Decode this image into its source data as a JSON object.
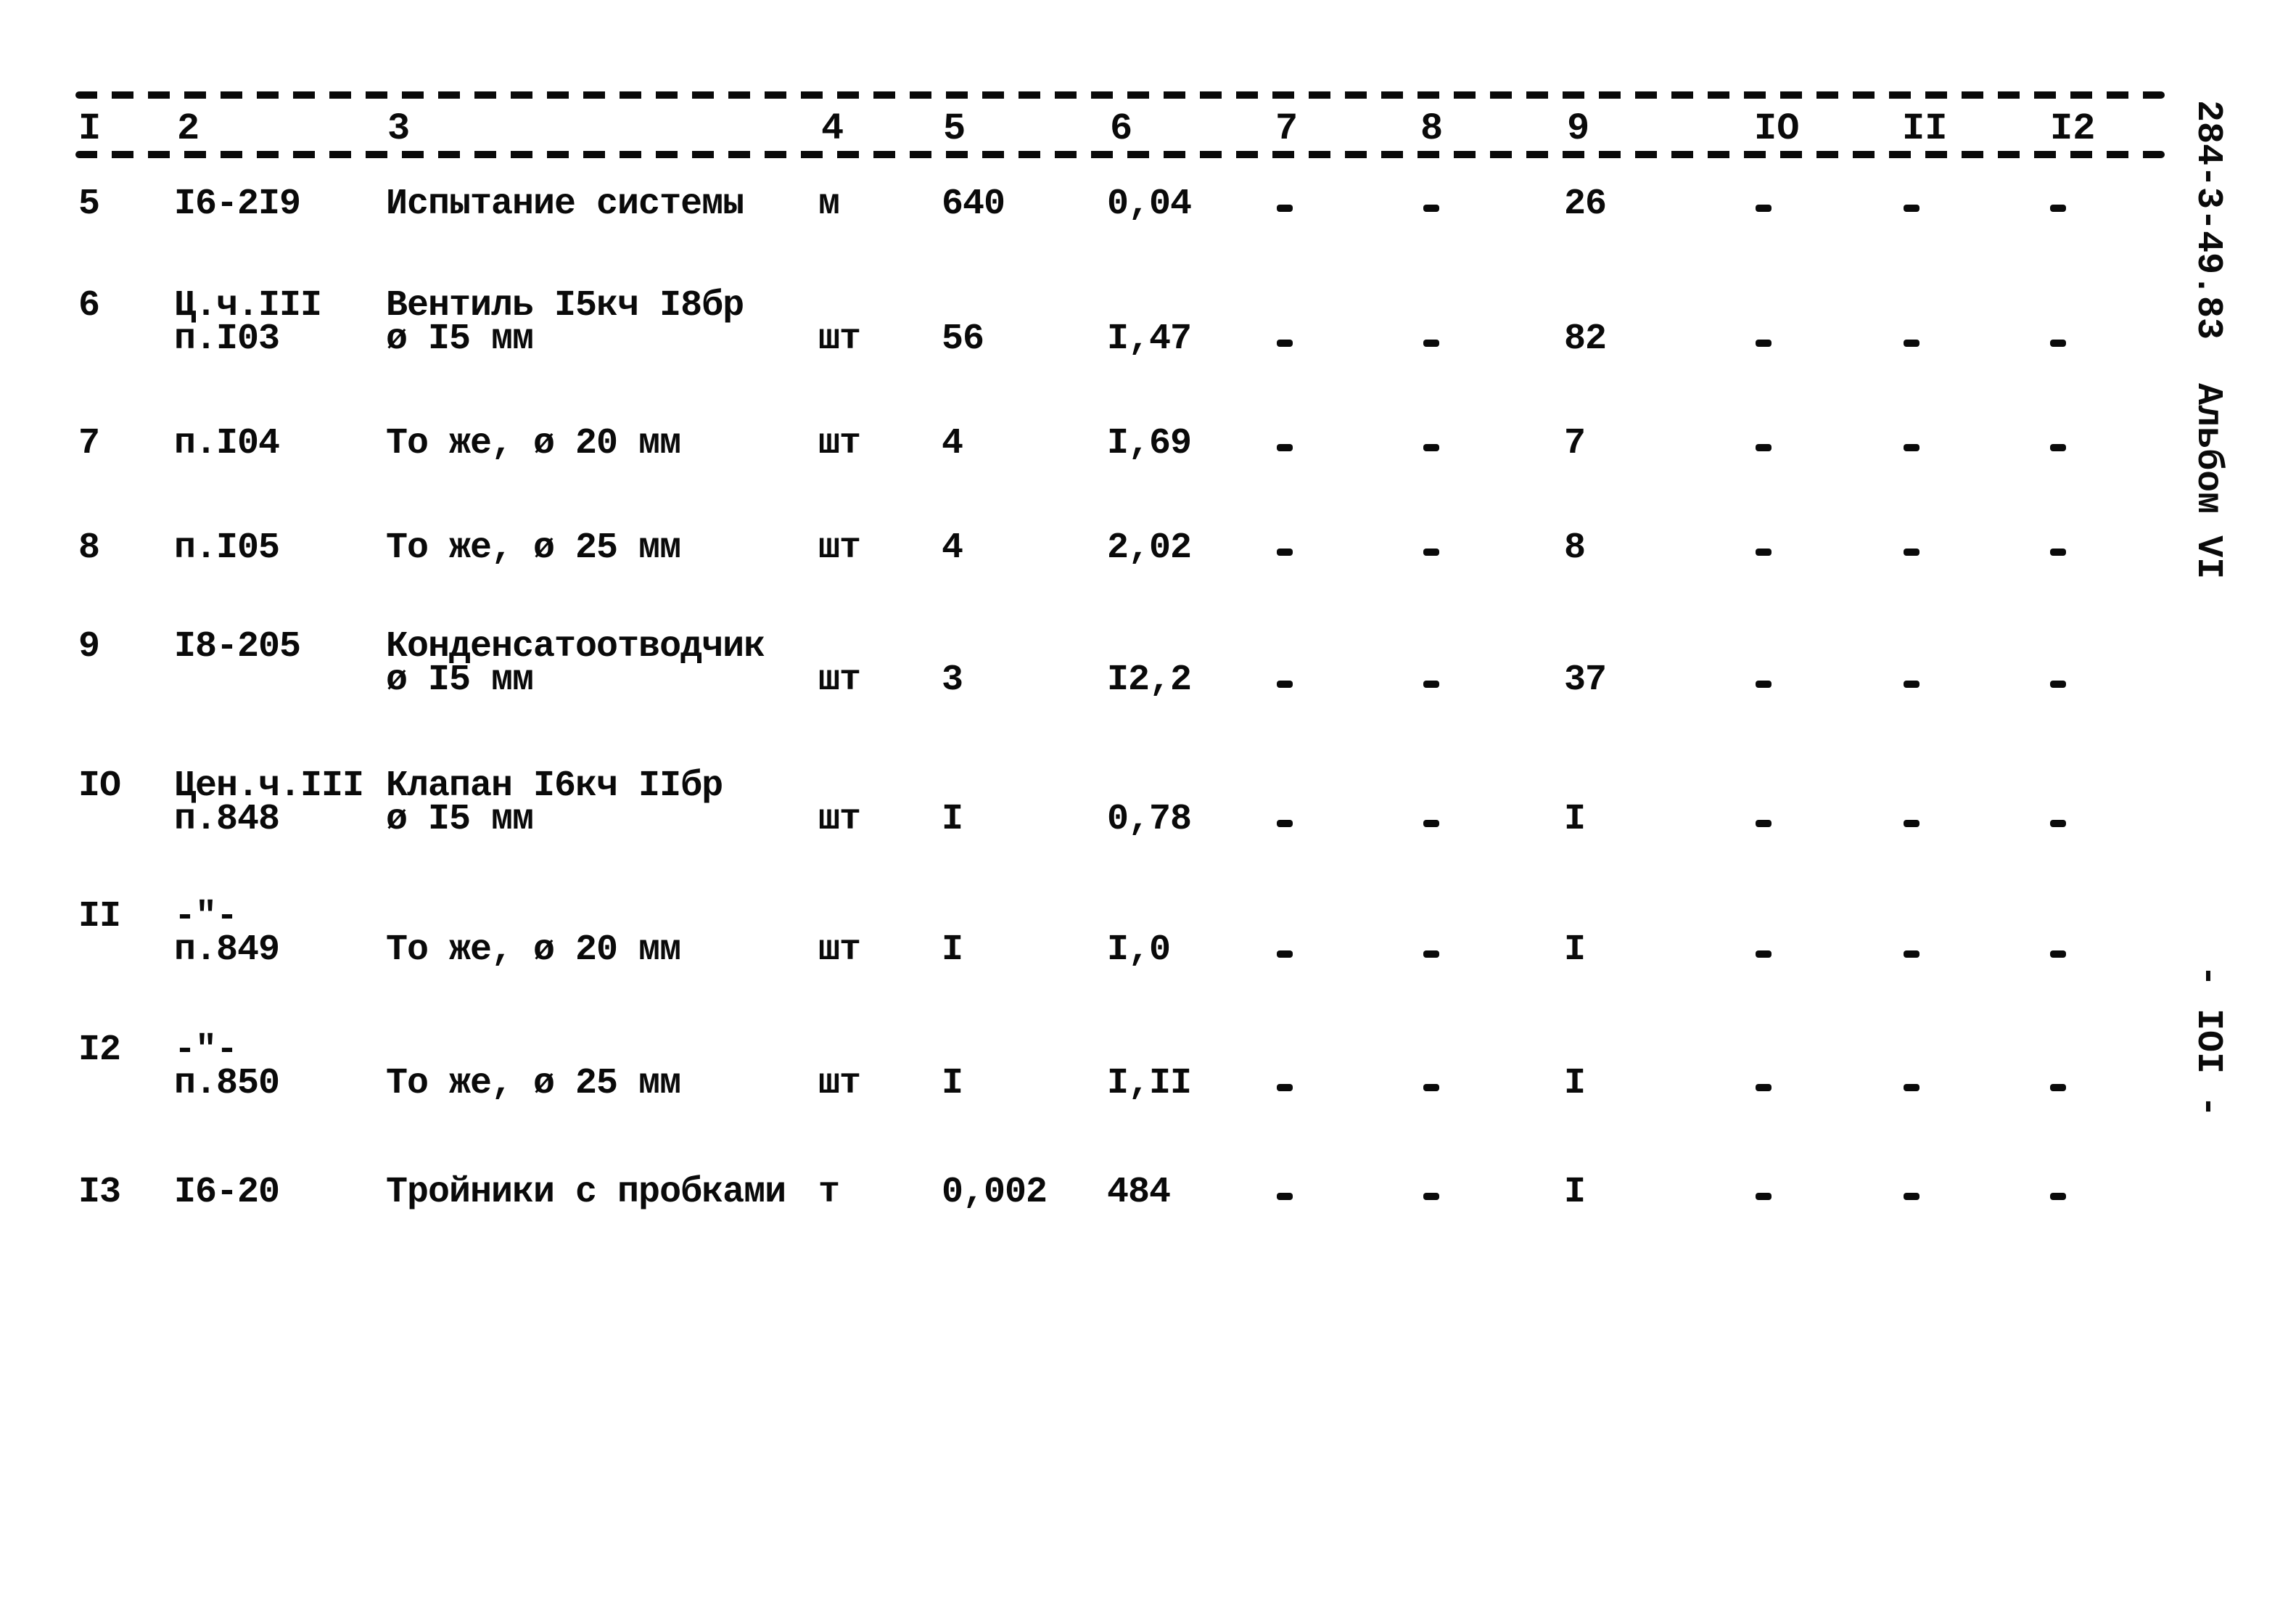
{
  "document": {
    "margin_code": "284-3-49.83  Альбом VI",
    "page_number": "- IOI -"
  },
  "table": {
    "columns": [
      "I",
      "2",
      "3",
      "4",
      "5",
      "6",
      "7",
      "8",
      "9",
      "IO",
      "II",
      "I2"
    ],
    "rows": [
      {
        "n": "5",
        "ref": [
          "I6-2I9"
        ],
        "name": [
          "Испытание системы"
        ],
        "unit": "м",
        "qty": "640",
        "c6": "0,04",
        "c7": "-",
        "c8": "-",
        "c9": "26",
        "c10": "-",
        "c11": "-",
        "c12": "-"
      },
      {
        "n": "6",
        "ref": [
          "Ц.ч.III",
          "п.I03"
        ],
        "name": [
          "Вентиль I5кч I8бр",
          "ø I5 мм"
        ],
        "unit": "шт",
        "qty": "56",
        "c6": "I,47",
        "c7": "-",
        "c8": "-",
        "c9": "82",
        "c10": "-",
        "c11": "-",
        "c12": "-"
      },
      {
        "n": "7",
        "ref": [
          "п.I04"
        ],
        "name": [
          "То же, ø 20 мм"
        ],
        "unit": "шт",
        "qty": "4",
        "c6": "I,69",
        "c7": "-",
        "c8": "-",
        "c9": "7",
        "c10": "-",
        "c11": "-",
        "c12": "-"
      },
      {
        "n": "8",
        "ref": [
          "п.I05"
        ],
        "name": [
          "То же, ø 25 мм"
        ],
        "unit": "шт",
        "qty": "4",
        "c6": "2,02",
        "c7": "-",
        "c8": "-",
        "c9": "8",
        "c10": "-",
        "c11": "-",
        "c12": "-"
      },
      {
        "n": "9",
        "ref": [
          "I8-205"
        ],
        "name": [
          "Конденсатоотводчик",
          "ø I5 мм"
        ],
        "unit": "шт",
        "qty": "3",
        "c6": "I2,2",
        "c7": "-",
        "c8": "-",
        "c9": "37",
        "c10": "-",
        "c11": "-",
        "c12": "-"
      },
      {
        "n": "IO",
        "ref": [
          "Цен.ч.III",
          "п.848"
        ],
        "name": [
          "Клапан I6кч IIбр",
          "ø I5 мм"
        ],
        "unit": "шт",
        "qty": "I",
        "c6": "0,78",
        "c7": "-",
        "c8": "-",
        "c9": "I",
        "c10": "-",
        "c11": "-",
        "c12": "-"
      },
      {
        "n": "II",
        "ref": [
          "-\"-",
          "п.849"
        ],
        "name": [
          "",
          "То же, ø 20 мм"
        ],
        "unit": "шт",
        "qty": "I",
        "c6": "I,0",
        "c7": "-",
        "c8": "-",
        "c9": "I",
        "c10": "-",
        "c11": "-",
        "c12": "-"
      },
      {
        "n": "I2",
        "ref": [
          "-\"-",
          "п.850"
        ],
        "name": [
          "",
          "То же, ø 25 мм"
        ],
        "unit": "шт",
        "qty": "I",
        "c6": "I,II",
        "c7": "-",
        "c8": "-",
        "c9": "I",
        "c10": "-",
        "c11": "-",
        "c12": "-"
      },
      {
        "n": "I3",
        "ref": [
          "I6-20"
        ],
        "name": [
          "Тройники с пробками"
        ],
        "unit": "т",
        "qty": "0,002",
        "c6": "484",
        "c7": "-",
        "c8": "-",
        "c9": "I",
        "c10": "-",
        "c11": "-",
        "c12": "-"
      }
    ]
  }
}
